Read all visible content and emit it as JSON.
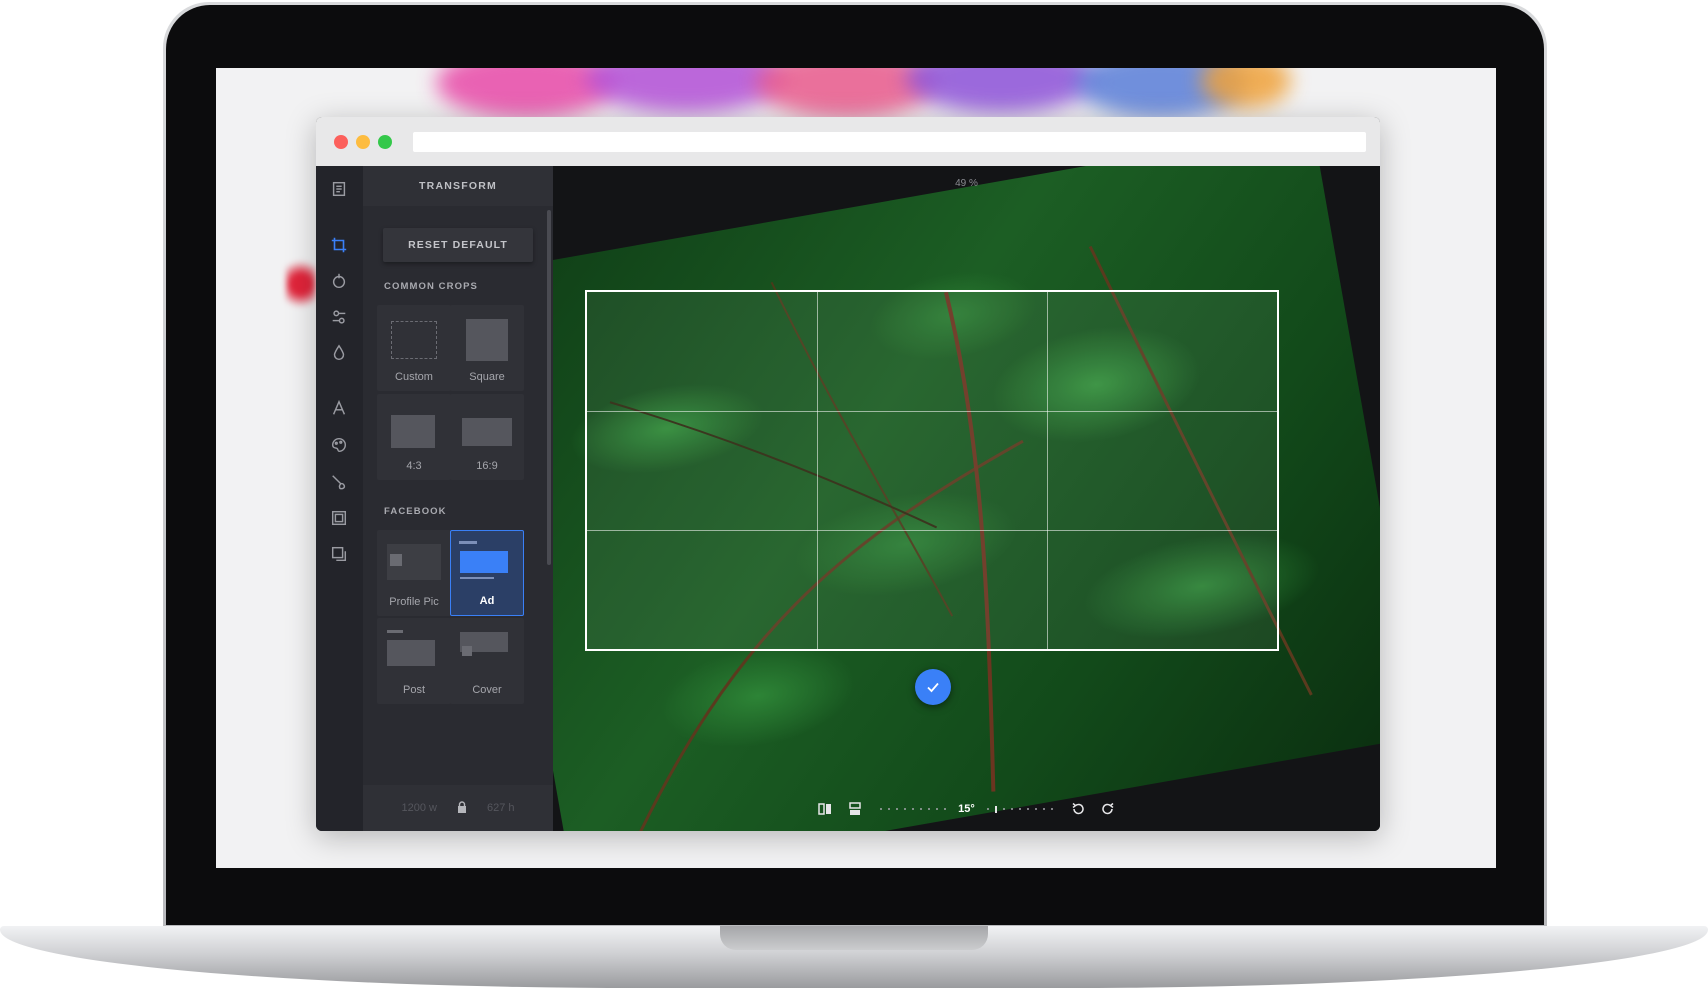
{
  "editor": {
    "panel_title": "TRANSFORM",
    "reset_label": "RESET DEFAULT",
    "sections": {
      "common_crops_label": "COMMON CROPS",
      "facebook_label": "FACEBOOK"
    },
    "common_crops": [
      {
        "label": "Custom"
      },
      {
        "label": "Square"
      },
      {
        "label": "4:3"
      },
      {
        "label": "16:9"
      }
    ],
    "facebook_crops": [
      {
        "label": "Profile Pic",
        "selected": false
      },
      {
        "label": "Ad",
        "selected": true
      },
      {
        "label": "Post",
        "selected": false
      },
      {
        "label": "Cover",
        "selected": false
      }
    ],
    "dimensions": {
      "width_value": "1200",
      "width_unit": "w",
      "height_value": "627",
      "height_unit": "h"
    },
    "rail_icons": [
      "document-icon",
      "crop-icon",
      "filter-icon",
      "adjust-icon",
      "drop-icon",
      "text-icon",
      "sticker-icon",
      "brush-icon",
      "frame-icon",
      "overlay-icon"
    ]
  },
  "canvas": {
    "zoom_label": "49 %",
    "rotation_label": "15°"
  },
  "colors": {
    "accent": "#3a80f7",
    "panel_bg": "#2a2b31",
    "rail_bg": "#23242a"
  }
}
